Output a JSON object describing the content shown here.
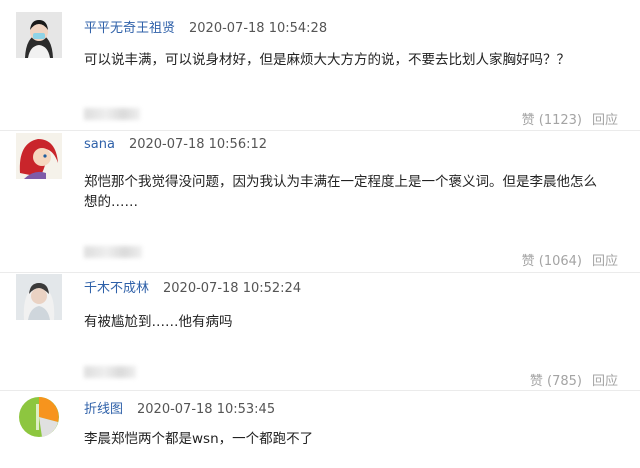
{
  "comments": [
    {
      "username": "平平无奇王祖贤",
      "timestamp": "2020-07-18 10:54:28",
      "text": "可以说丰满，可以说身材好，但是麻烦大大方方的说，不要去比划人家胸好吗？？",
      "like_label": "赞",
      "like_count": "(1123)",
      "reply_label": "回应"
    },
    {
      "username": "sana",
      "timestamp": "2020-07-18 10:56:12",
      "text": "郑恺那个我觉得没问题，因为我认为丰满在一定程度上是一个褒义词。但是李晨他怎么想的……",
      "like_label": "赞",
      "like_count": "(1064)",
      "reply_label": "回应"
    },
    {
      "username": "千木不成林",
      "timestamp": "2020-07-18 10:52:24",
      "text": "有被尴尬到……他有病吗",
      "like_label": "赞",
      "like_count": "(785)",
      "reply_label": "回应"
    },
    {
      "username": "折线图",
      "timestamp": "2020-07-18 10:53:45",
      "text": "李晨郑恺两个都是wsn，一个都跑不了"
    }
  ],
  "colors": {
    "username": "#2f61a9",
    "action": "#a4a4a4",
    "text": "#222222"
  }
}
